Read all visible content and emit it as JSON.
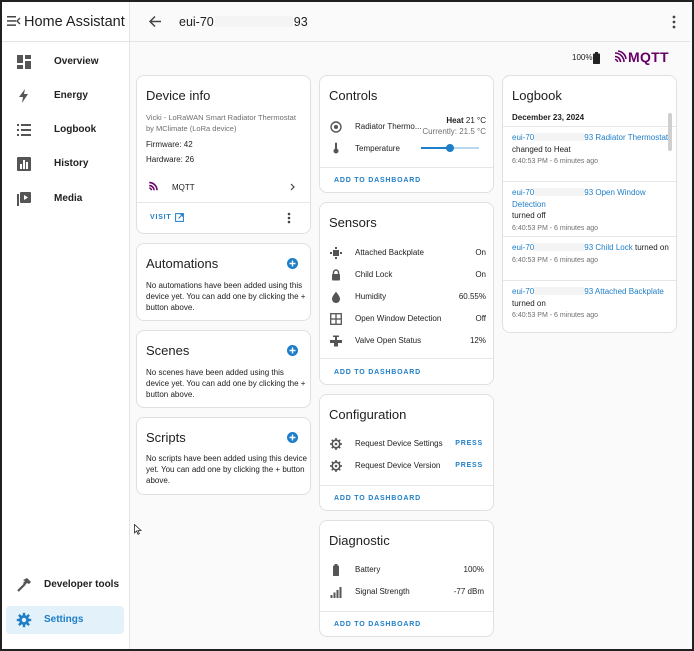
{
  "app": {
    "title": "Home Assistant"
  },
  "sidebar": {
    "items": [
      {
        "label": "Overview",
        "icon": "overview-icon"
      },
      {
        "label": "Energy",
        "icon": "energy-icon"
      },
      {
        "label": "Logbook",
        "icon": "logbook-icon"
      },
      {
        "label": "History",
        "icon": "history-icon"
      },
      {
        "label": "Media",
        "icon": "media-icon"
      }
    ],
    "bottom": [
      {
        "label": "Developer tools",
        "icon": "hammer-icon"
      },
      {
        "label": "Settings",
        "icon": "gear-icon",
        "active": true
      }
    ]
  },
  "header": {
    "title_prefix": "eui-70",
    "title_suffix": "93"
  },
  "status": {
    "battery": "100%",
    "integration_logo": "MQTT"
  },
  "device_info": {
    "title": "Device info",
    "model": "Vicki - LoRaWAN Smart Radiator Thermostat",
    "manufacturer": "by MClimate (LoRa device)",
    "firmware": "Firmware: 42",
    "hardware": "Hardware: 26",
    "integration": "MQTT",
    "visit": "VISIT"
  },
  "automations": {
    "title": "Automations",
    "text": "No automations have been added using this device yet. You can add one by clicking the + button above."
  },
  "scenes": {
    "title": "Scenes",
    "text": "No scenes have been added using this device yet. You can add one by clicking the + button above."
  },
  "scripts": {
    "title": "Scripts",
    "text": "No scripts have been added using this device yet. You can add one by clicking the + button above."
  },
  "controls": {
    "title": "Controls",
    "thermostat_label": "Radiator Thermo...",
    "thermostat_mode": "Heat",
    "thermostat_target": "21 °C",
    "thermostat_current": "Currently: 21.5 °C",
    "temperature_label": "Temperature",
    "slider_fraction": 0.5,
    "add": "ADD TO DASHBOARD"
  },
  "sensors": {
    "title": "Sensors",
    "rows": [
      {
        "label": "Attached Backplate",
        "value": "On",
        "icon": "backplate-icon"
      },
      {
        "label": "Child Lock",
        "value": "On",
        "icon": "lock-icon"
      },
      {
        "label": "Humidity",
        "value": "60.55%",
        "icon": "water-drop-icon"
      },
      {
        "label": "Open Window Detection",
        "value": "Off",
        "icon": "window-icon"
      },
      {
        "label": "Valve Open Status",
        "value": "12%",
        "icon": "valve-icon"
      }
    ],
    "add": "ADD TO DASHBOARD"
  },
  "configuration": {
    "title": "Configuration",
    "rows": [
      {
        "label": "Request Device Settings",
        "action": "PRESS"
      },
      {
        "label": "Request Device Version",
        "action": "PRESS"
      }
    ],
    "add": "ADD TO DASHBOARD"
  },
  "diagnostic": {
    "title": "Diagnostic",
    "rows": [
      {
        "label": "Battery",
        "value": "100%"
      },
      {
        "label": "Signal Strength",
        "value": "-77 dBm"
      }
    ],
    "add": "ADD TO DASHBOARD"
  },
  "logbook": {
    "title": "Logbook",
    "date": "December 23, 2024",
    "entries": [
      {
        "prefix": "eui-70",
        "entity": "93 Radiator Thermostat",
        "action": "changed to Heat",
        "time": "6:40:53 PM - 6 minutes ago"
      },
      {
        "prefix": "eui-70",
        "entity": "93 Open Window Detection",
        "action": "turned off",
        "time": "6:40:53 PM - 6 minutes ago"
      },
      {
        "prefix": "eui-70",
        "entity": "93 Child Lock",
        "action": "turned on",
        "time": "6:40:53 PM - 6 minutes ago"
      },
      {
        "prefix": "eui-70",
        "entity": "93 Attached Backplate",
        "action": "turned on",
        "time": "6:40:53 PM - 6 minutes ago"
      }
    ]
  },
  "colors": {
    "accent": "#1e7ec8",
    "mqtt": "#660066",
    "active_bg": "#e3f1fb"
  }
}
